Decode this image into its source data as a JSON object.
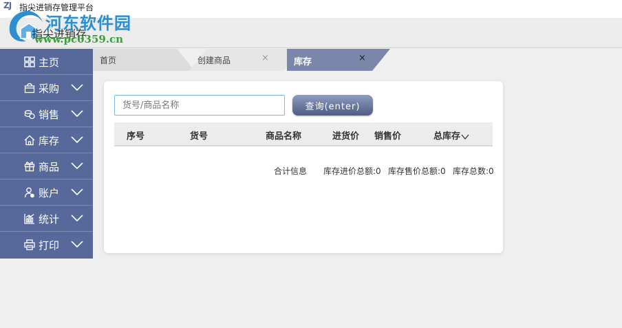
{
  "titlebar": {
    "mark": "ZJ",
    "title": "指尖进销存管理平台"
  },
  "header": {
    "brand": "指尖进销存",
    "watermark": "河东软件园",
    "watermark_url": "www.pc0359.cn"
  },
  "sidebar": {
    "items": [
      {
        "label": "主页",
        "icon": "grid-icon"
      },
      {
        "label": "采购",
        "icon": "bag-icon"
      },
      {
        "label": "销售",
        "icon": "coin-icon"
      },
      {
        "label": "库存",
        "icon": "home-icon"
      },
      {
        "label": "商品",
        "icon": "gift-icon"
      },
      {
        "label": "账户",
        "icon": "user-icon"
      },
      {
        "label": "统计",
        "icon": "bar-chart-icon"
      },
      {
        "label": "打印",
        "icon": "printer-icon"
      }
    ]
  },
  "tabs": {
    "home": "首页",
    "create": "创建商品",
    "stock": "库存",
    "close_glyph": "×"
  },
  "search": {
    "placeholder": "货号/商品名称",
    "button": "查询(enter)"
  },
  "table": {
    "columns": [
      "序号",
      "货号",
      "商品名称",
      "进货价",
      "销售价",
      "总库存"
    ]
  },
  "summary": {
    "label": "合计信息",
    "cost_total": "库存进价总额:0",
    "sale_total": "库存售价总额:0",
    "qty_total": "库存总数:0"
  },
  "colors": {
    "sidebar": "#56699a",
    "active_tab": "#7a87ab",
    "button": "#5b6890",
    "watermark": "#2a8fd2"
  }
}
